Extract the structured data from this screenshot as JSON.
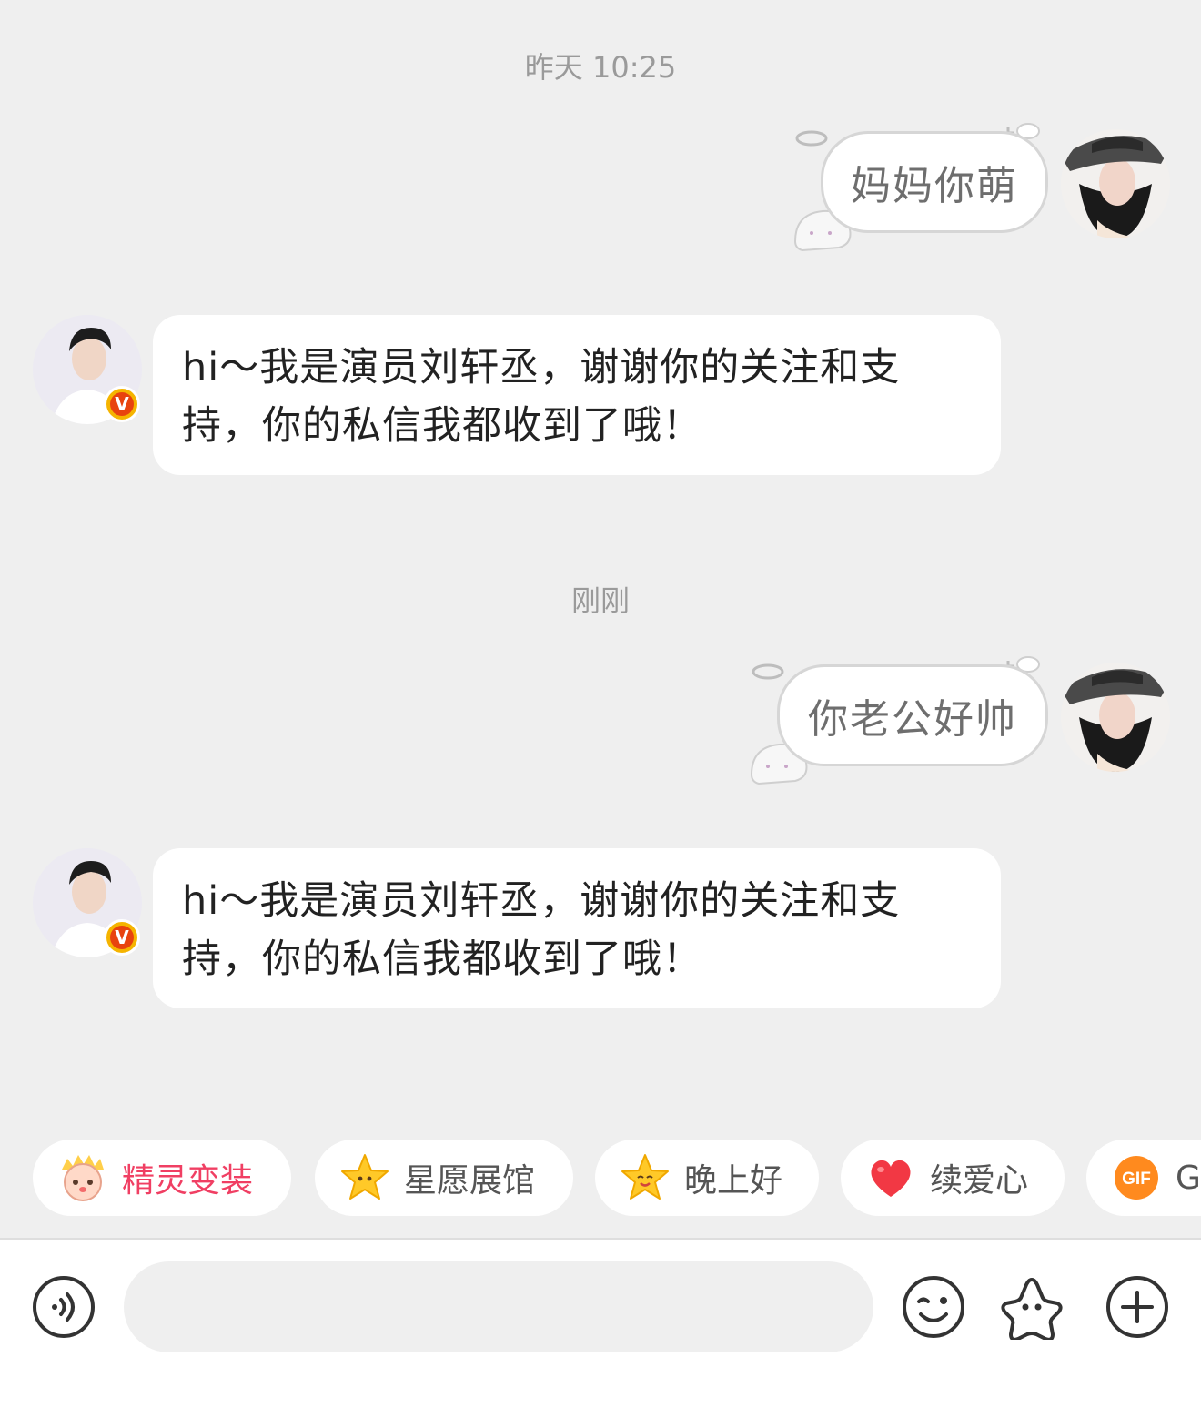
{
  "messages": [
    {
      "type": "timestamp",
      "text": "昨天 10:25"
    },
    {
      "type": "outgoing",
      "text": "妈妈你萌",
      "avatar": "user-avatar-hat-girl"
    },
    {
      "type": "incoming",
      "line1": "hi～我是演员刘轩丞，谢谢你的关注和支",
      "line2": "持，你的私信我都收到了哦！",
      "avatar": "actor-avatar",
      "verified": "V"
    },
    {
      "type": "timestamp",
      "text": "刚刚"
    },
    {
      "type": "outgoing",
      "text": "你老公好帅",
      "avatar": "user-avatar-hat-girl"
    },
    {
      "type": "incoming",
      "line1": "hi～我是演员刘轩丞，谢谢你的关注和支",
      "line2": "持，你的私信我都收到了哦！",
      "avatar": "actor-avatar",
      "verified": "V"
    }
  ],
  "quick_actions": [
    {
      "label": "精灵变装",
      "icon": "sprite-icon",
      "color": "#f03f63"
    },
    {
      "label": "星愿展馆",
      "icon": "star-icon",
      "color": "#555555"
    },
    {
      "label": "晚上好",
      "icon": "star-face-icon",
      "color": "#555555"
    },
    {
      "label": "续爱心",
      "icon": "heart-icon",
      "color": "#555555"
    },
    {
      "label": "GIF",
      "icon": "gif-icon",
      "color": "#555555"
    }
  ],
  "toolbar": {
    "voice_icon": "voice-icon",
    "input_placeholder": "",
    "emoji_icon": "emoji-icon",
    "sticker_icon": "sticker-star-icon",
    "more_icon": "plus-icon"
  },
  "colors": {
    "background": "#efefef",
    "bubble": "#ffffff",
    "accent": "#f03f63",
    "verified": "#f5b400"
  }
}
